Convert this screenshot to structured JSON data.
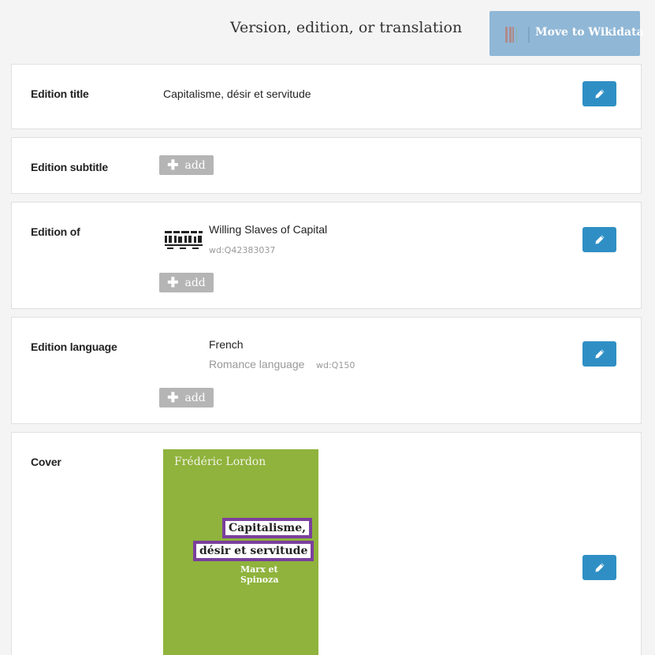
{
  "header": {
    "title": "Version, edition, or translation",
    "move_button_label": "Move to Wikidata",
    "wikidata_logo_colors": [
      "#990000",
      "#339966",
      "#006699"
    ]
  },
  "rows": {
    "title": {
      "label": "Edition title",
      "value": "Capitalisme, désir et servitude"
    },
    "subtitle": {
      "label": "Edition subtitle",
      "add_label": "add"
    },
    "edition_of": {
      "label": "Edition of",
      "value": "Willing Slaves of Capital",
      "wd_id": "wd:Q42383037",
      "add_label": "add"
    },
    "language": {
      "label": "Edition language",
      "value": "French",
      "description": "Romance language",
      "wd_id": "wd:Q150",
      "add_label": "add"
    },
    "cover": {
      "label": "Cover",
      "author": "Frédéric Lordon",
      "line1": "Capitalisme,",
      "line2": "désir et servitude",
      "line3": "Marx et Spinoza"
    }
  },
  "icons": {
    "edit": "pencil-icon",
    "add": "plus-icon"
  },
  "colors": {
    "edit_button": "#2f8fc4",
    "add_button": "#b5b5b5",
    "move_button": "#90b7d6"
  }
}
